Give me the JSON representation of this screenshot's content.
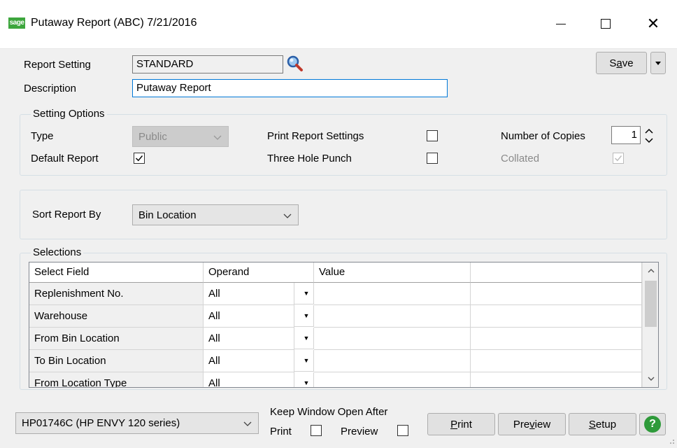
{
  "window": {
    "logo_text": "sage",
    "title": "Putaway Report (ABC) 7/21/2016"
  },
  "header": {
    "report_setting_label": "Report Setting",
    "report_setting_value": "STANDARD",
    "description_label": "Description",
    "description_value": "Putaway Report",
    "save_prefix": "S",
    "save_underline": "a",
    "save_suffix": "ve"
  },
  "setting_options": {
    "legend": "Setting Options",
    "type_label": "Type",
    "type_value": "Public",
    "default_report_label": "Default Report",
    "default_report_checked": true,
    "print_report_settings_label": "Print Report Settings",
    "print_report_settings_checked": false,
    "three_hole_punch_label": "Three Hole Punch",
    "three_hole_punch_checked": false,
    "number_of_copies_label": "Number of Copies",
    "number_of_copies_value": "1",
    "collated_label": "Collated",
    "collated_checked": true
  },
  "sort": {
    "label": "Sort Report By",
    "value": "Bin Location"
  },
  "selections": {
    "legend": "Selections",
    "columns": [
      "Select Field",
      "Operand",
      "Value",
      ""
    ],
    "rows": [
      {
        "field": "Replenishment No.",
        "operand": "All",
        "value": ""
      },
      {
        "field": "Warehouse",
        "operand": "All",
        "value": ""
      },
      {
        "field": "From Bin Location",
        "operand": "All",
        "value": ""
      },
      {
        "field": "To Bin Location",
        "operand": "All",
        "value": ""
      },
      {
        "field": "From Location Type",
        "operand": "All",
        "value": ""
      }
    ]
  },
  "footer": {
    "printer": "HP01746C (HP ENVY 120 series)",
    "keep_open_label": "Keep Window Open After",
    "print_check_label": "Print",
    "preview_check_label": "Preview",
    "print_button": {
      "underline": "P",
      "rest": "rint"
    },
    "preview_button": {
      "prefix": "Pre",
      "underline": "v",
      "suffix": "iew"
    },
    "setup_button": {
      "underline": "S",
      "rest": "etup"
    },
    "help_glyph": "?"
  },
  "colors": {
    "sage_green": "#3da63d",
    "help_green": "#2e9a3a",
    "focus_border": "#0078d7"
  }
}
